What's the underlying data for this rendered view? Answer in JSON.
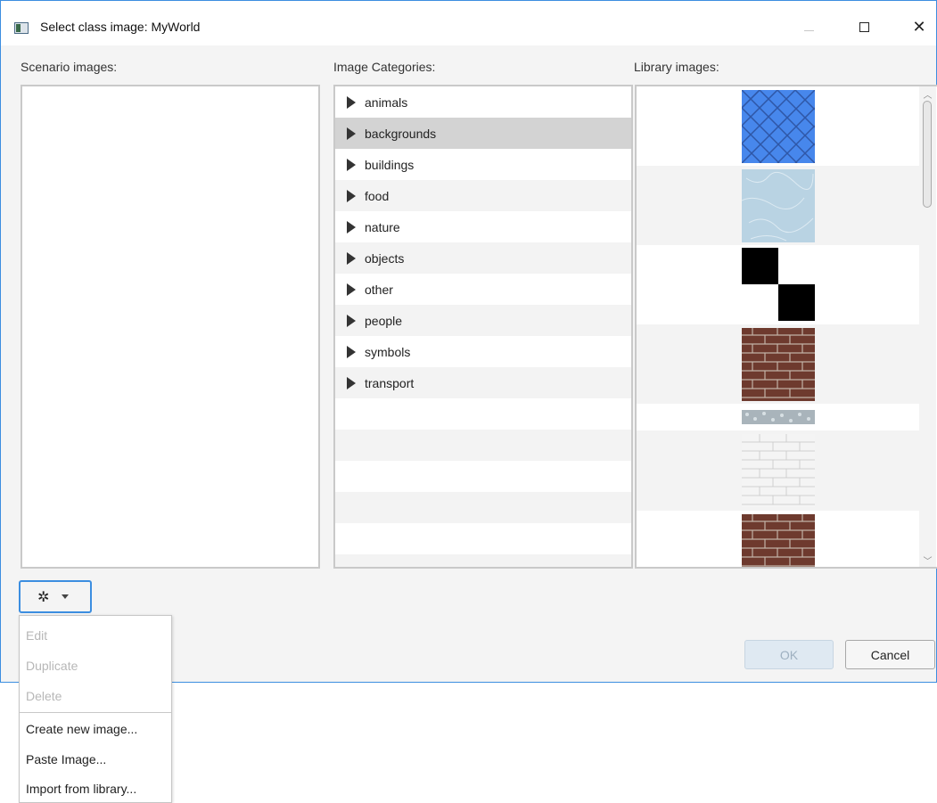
{
  "window": {
    "title": "Select class image: MyWorld"
  },
  "icons": {
    "app": "app-window-icon",
    "minimize": "minimize-icon",
    "maximize": "maximize-icon",
    "close": "close-icon",
    "gear": "gear-icon",
    "dropdown": "chevron-down-icon",
    "expand": "triangle-right-icon"
  },
  "window_controls": {
    "close_glyph": "✕",
    "gear_glyph": "✲"
  },
  "labels": {
    "scenario": "Scenario images:",
    "categories": "Image Categories:",
    "library": "Library images:"
  },
  "categories": [
    "animals",
    "backgrounds",
    "buildings",
    "food",
    "nature",
    "objects",
    "other",
    "people",
    "symbols",
    "transport"
  ],
  "selected_category": "backgrounds",
  "library_thumbnails": [
    "blue-diamond-tile",
    "light-blue-marble",
    "black-checker-squares",
    "red-brick-wall",
    "grey-gravel-strip",
    "white-stone-wall",
    "red-brick-wall"
  ],
  "buttons": {
    "ok": "OK",
    "cancel": "Cancel"
  },
  "menu": {
    "disabled_items": [
      "Edit",
      "Duplicate",
      "Delete"
    ],
    "enabled_items": [
      "Create new image...",
      "Paste Image...",
      "Import from library..."
    ]
  },
  "colors": {
    "accent": "#3c8ee0",
    "selected_row": "#d3d3d3",
    "alt_row": "#f3f3f3",
    "disabled_text": "#b7b7b7"
  }
}
